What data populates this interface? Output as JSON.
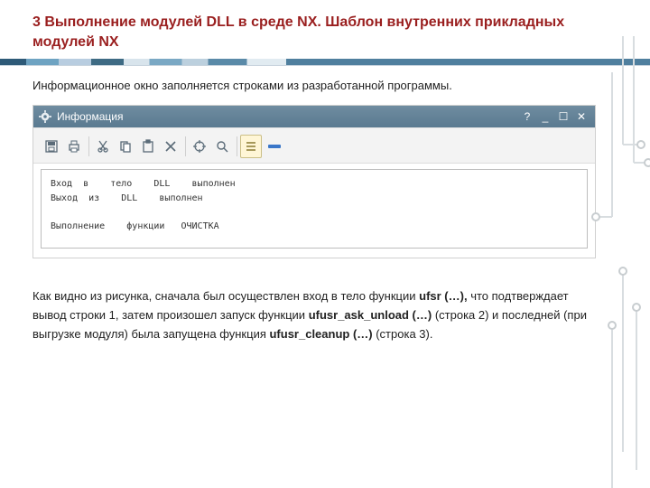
{
  "heading": "3 Выполнение модулей DLL в среде NX. Шаблон внутренних прикладных модулей NX",
  "intro": "Информационное окно заполняется строками из разработанной программы.",
  "window": {
    "title": "Информация",
    "controls": {
      "help": "?",
      "min": "_",
      "max": "☐",
      "close": "✕"
    }
  },
  "console": {
    "lines": [
      "Вход  в    тело    DLL    выполнен",
      "Выход  из    DLL    выполнен",
      "",
      "Выполнение    функции   ОЧИСТКА"
    ]
  },
  "explain": {
    "t1": "Как видно из рисунка, сначала был осуществлен вход в тело функции ",
    "b1": "ufsr (…),",
    "t2": " что подтверждает вывод строки  1,    затем произошел запуск функции ",
    "b2": "ufusr_ask_unload (…)",
    "t3": "   (строка 2) и последней (при  выгрузке  модуля)  была  запущена  функция ",
    "b3": "ufusr_cleanup (…)",
    "t4": " (строка 3)."
  }
}
